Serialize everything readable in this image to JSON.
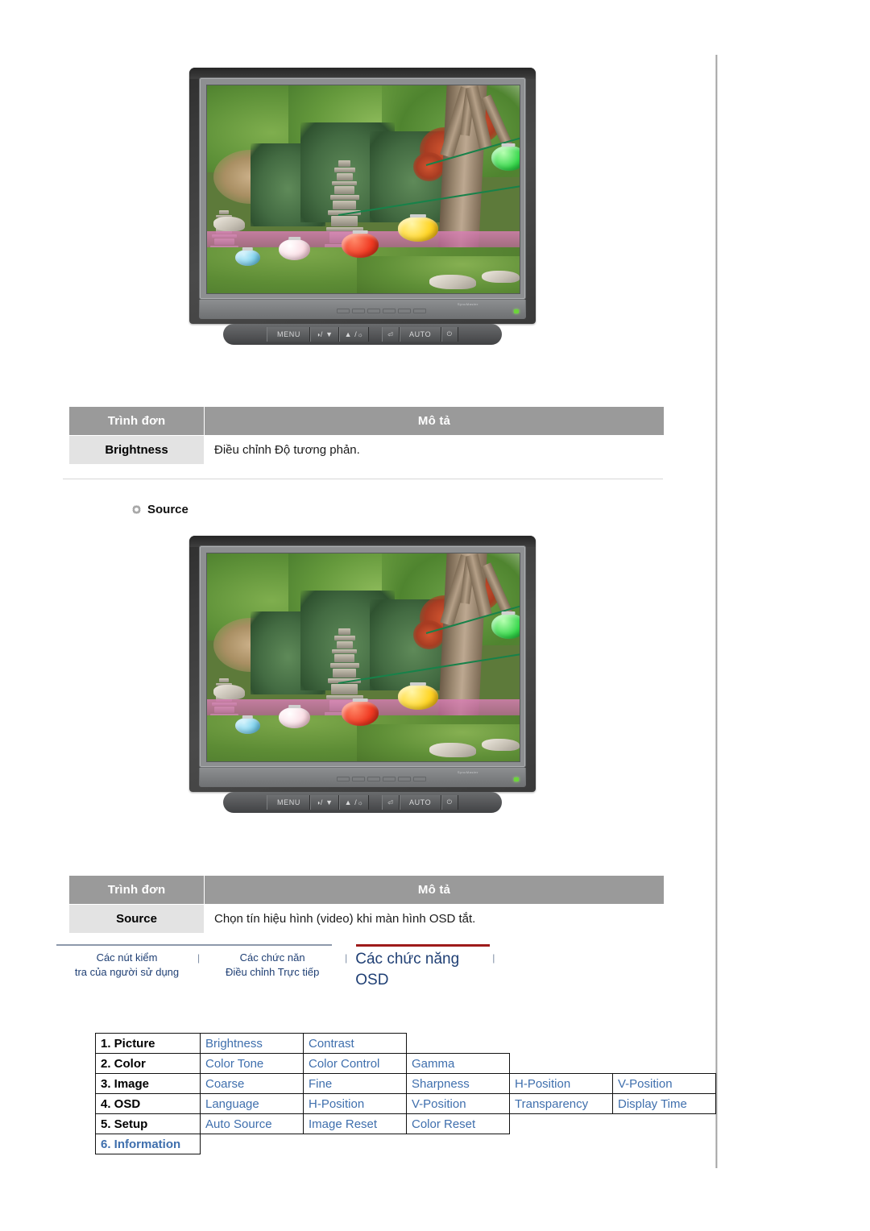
{
  "monitor": {
    "brand_text": "SyncMaster",
    "buttons": [
      {
        "name": "menu",
        "label": "MENU"
      },
      {
        "name": "brightness-down",
        "label": "/ ▼",
        "glyph": "◑"
      },
      {
        "name": "brightness-up",
        "label": "▲ /",
        "glyph": "☼"
      },
      {
        "name": "source",
        "label": "",
        "glyph": "⏎"
      },
      {
        "name": "auto",
        "label": "AUTO"
      },
      {
        "name": "power",
        "label": "",
        "glyph": "⏻"
      }
    ],
    "screen_alt": "Ảnh vườn với tháp đá và đèn lồng màu"
  },
  "table_brightness": {
    "headers": {
      "menu": "Trình đơn",
      "description": "Mô tả"
    },
    "rows": [
      {
        "label": "Brightness",
        "value": "Điều chỉnh Độ tương phản."
      }
    ]
  },
  "section_source": {
    "title": "Source",
    "bullet_icon": "gear-bullet-icon"
  },
  "table_source": {
    "headers": {
      "menu": "Trình đơn",
      "description": "Mô tả"
    },
    "rows": [
      {
        "label": "Source",
        "value": "Chọn tín hiệu hình (video) khi màn hình OSD tắt."
      }
    ]
  },
  "tabs": {
    "items": [
      {
        "label": "Các nút kiểm\ntra của người sử dụng",
        "active": false
      },
      {
        "label": "Các chức năn\nĐiều chỉnh Trực tiếp",
        "active": false
      },
      {
        "label": "Các chức năng OSD",
        "active": true
      }
    ],
    "separator": "|",
    "active_border_color": "#9e1b1b",
    "link_color": "#1f3f74"
  },
  "osd_menu": {
    "rows": [
      {
        "label": "1. Picture",
        "label_is_link": false,
        "items": [
          "Brightness",
          "Contrast"
        ]
      },
      {
        "label": "2. Color",
        "label_is_link": false,
        "items": [
          "Color Tone",
          "Color Control",
          "Gamma"
        ]
      },
      {
        "label": "3. Image",
        "label_is_link": false,
        "items": [
          "Coarse",
          "Fine",
          "Sharpness",
          "H-Position",
          "V-Position"
        ]
      },
      {
        "label": "4. OSD",
        "label_is_link": false,
        "items": [
          "Language",
          "H-Position",
          "V-Position",
          "Transparency",
          "Display Time"
        ]
      },
      {
        "label": "5. Setup",
        "label_is_link": false,
        "items": [
          "Auto Source",
          "Image Reset",
          "Color Reset"
        ]
      },
      {
        "label": "6. Information",
        "label_is_link": true,
        "items": []
      }
    ],
    "link_color": "#3f6fad"
  }
}
